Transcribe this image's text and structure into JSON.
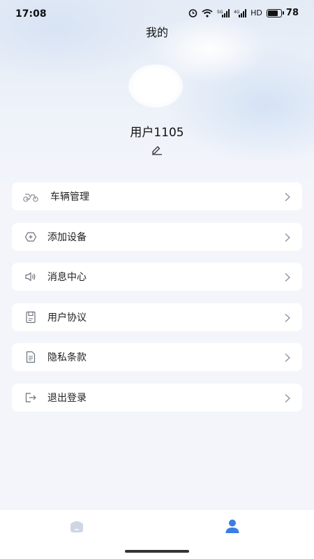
{
  "status_bar": {
    "time": "17:08",
    "network": "HD",
    "battery_level": "78",
    "icons": [
      "alarm-icon",
      "wifi-icon",
      "signal-icon",
      "signal-icon",
      "battery-icon"
    ]
  },
  "header": {
    "title": "我的"
  },
  "profile": {
    "username": "用户1105",
    "edit_icon": "edit-icon"
  },
  "menu": {
    "items": [
      {
        "label": "车辆管理",
        "icon": "scooter-icon"
      },
      {
        "label": "添加设备",
        "icon": "add-device-icon"
      },
      {
        "label": "消息中心",
        "icon": "speaker-icon"
      },
      {
        "label": "用户协议",
        "icon": "document-save-icon"
      },
      {
        "label": "隐私条款",
        "icon": "document-icon"
      },
      {
        "label": "退出登录",
        "icon": "logout-icon"
      }
    ]
  },
  "tab_bar": {
    "tabs": [
      {
        "name": "home",
        "icon": "home-icon",
        "active": false
      },
      {
        "name": "profile",
        "icon": "user-icon",
        "active": true
      }
    ],
    "active_color": "#3b7de3",
    "inactive_color": "#cfd6e3"
  }
}
